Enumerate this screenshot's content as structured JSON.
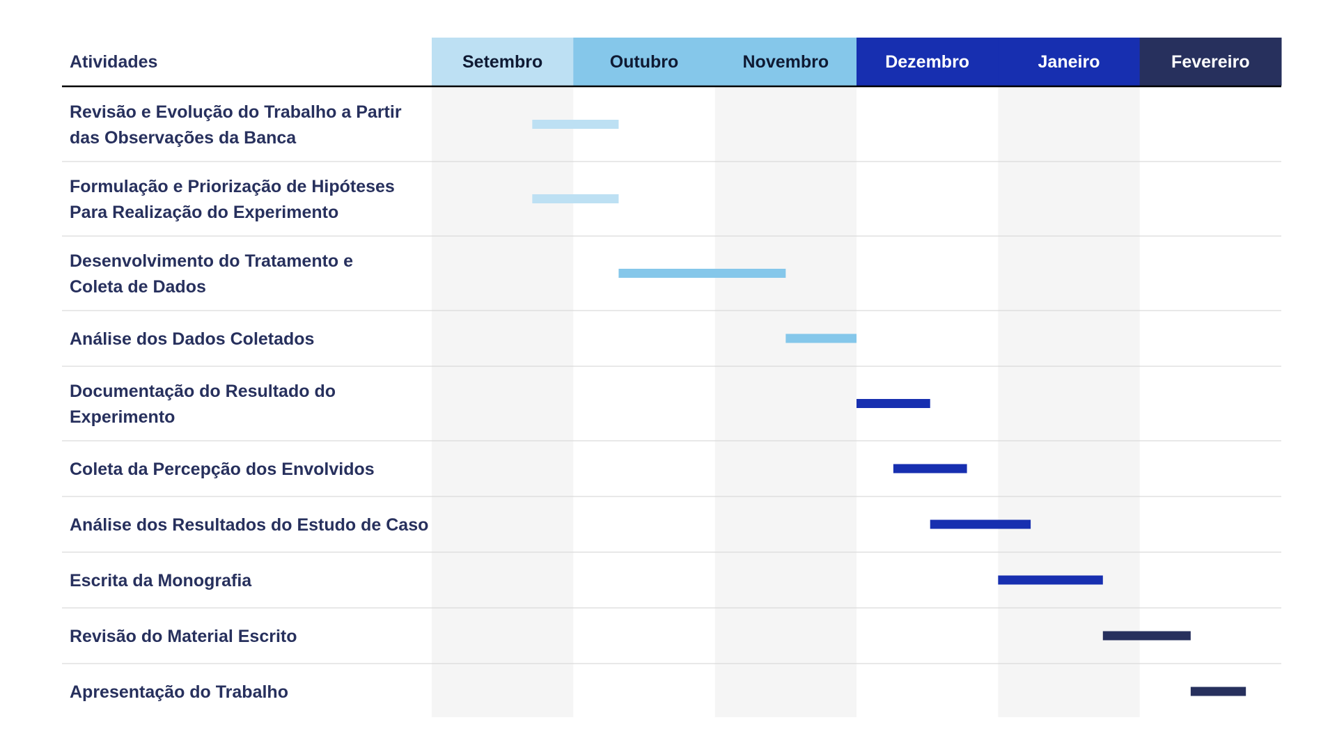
{
  "chart_data": {
    "type": "gantt",
    "header": {
      "activities_label": "Atividades"
    },
    "months": [
      {
        "label": "Setembro",
        "header_bg": "#bde0f3",
        "header_text": "#0f1a33",
        "shaded": true
      },
      {
        "label": "Outubro",
        "header_bg": "#85c7ea",
        "header_text": "#0f1a33",
        "shaded": false
      },
      {
        "label": "Novembro",
        "header_bg": "#85c7ea",
        "header_text": "#0f1a33",
        "shaded": true
      },
      {
        "label": "Dezembro",
        "header_bg": "#172fb0",
        "header_text": "#ffffff",
        "shaded": false
      },
      {
        "label": "Janeiro",
        "header_bg": "#172fb0",
        "header_text": "#ffffff",
        "shaded": true
      },
      {
        "label": "Fevereiro",
        "header_bg": "#27305d",
        "header_text": "#ffffff",
        "shaded": false
      }
    ],
    "tasks": [
      {
        "lines": [
          "Revisão e Evolução do Trabalho a Partir",
          "das Observações da Banca"
        ],
        "start": 0.71,
        "end": 1.32,
        "color": "#bde0f3"
      },
      {
        "lines": [
          "Formulação e Priorização de Hipóteses",
          "Para Realização do Experimento"
        ],
        "start": 0.71,
        "end": 1.32,
        "color": "#bde0f3"
      },
      {
        "lines": [
          "Desenvolvimento do Tratamento e",
          "Coleta de Dados"
        ],
        "start": 1.32,
        "end": 2.5,
        "color": "#85c7ea"
      },
      {
        "lines": [
          "Análise dos Dados Coletados"
        ],
        "start": 2.5,
        "end": 3.0,
        "color": "#85c7ea"
      },
      {
        "lines": [
          "Documentação do Resultado do",
          "Experimento"
        ],
        "start": 3.0,
        "end": 3.52,
        "color": "#172fb0"
      },
      {
        "lines": [
          "Coleta da Percepção dos Envolvidos"
        ],
        "start": 3.26,
        "end": 3.78,
        "color": "#172fb0"
      },
      {
        "lines": [
          "Análise dos Resultados do Estudo de Caso"
        ],
        "start": 3.52,
        "end": 4.23,
        "color": "#172fb0"
      },
      {
        "lines": [
          "Escrita da Monografia"
        ],
        "start": 4.0,
        "end": 4.74,
        "color": "#172fb0"
      },
      {
        "lines": [
          "Revisão do Material Escrito"
        ],
        "start": 4.74,
        "end": 5.36,
        "color": "#27305d"
      },
      {
        "lines": [
          "Apresentação do Trabalho"
        ],
        "start": 5.36,
        "end": 5.75,
        "color": "#27305d"
      }
    ],
    "colors": {
      "label_text": "#27305d",
      "shade": "#f5f5f5",
      "divider": "#d9d9d9",
      "header_rule": "#000000"
    }
  }
}
